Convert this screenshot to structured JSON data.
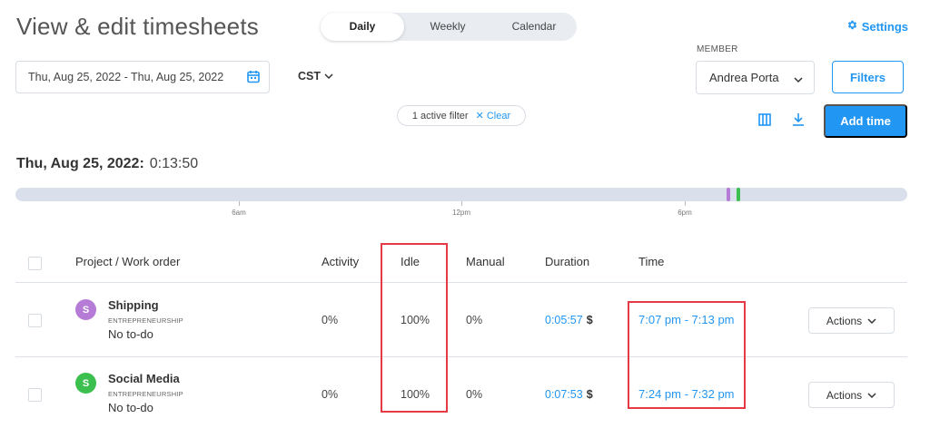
{
  "header": {
    "title": "View & edit timesheets",
    "view_options": [
      "Daily",
      "Weekly",
      "Calendar"
    ],
    "active_view": "Daily",
    "settings_label": "Settings"
  },
  "toolbar": {
    "date_range": "Thu, Aug 25, 2022 - Thu, Aug 25, 2022",
    "timezone": "CST",
    "member_label": "MEMBER",
    "member_value": "Andrea Porta",
    "filters_label": "Filters",
    "active_filter_text": "1 active filter",
    "clear_label": "Clear",
    "add_time_label": "Add time"
  },
  "day": {
    "date": "Thu, Aug 25, 2022:",
    "total": "0:13:50",
    "timeline_ticks": [
      "6am",
      "12pm",
      "6pm"
    ],
    "segments": [
      {
        "color": "#b57bd6"
      },
      {
        "color": "#3bbf4e"
      }
    ]
  },
  "table": {
    "columns": [
      "Project / Work order",
      "Activity",
      "Idle",
      "Manual",
      "Duration",
      "Time"
    ],
    "rows": [
      {
        "avatar_letter": "S",
        "avatar_color": "#b57bd6",
        "project": "Shipping",
        "client": "ENTREPRENEURSHIP",
        "todo": "No to-do",
        "activity": "0%",
        "idle": "100%",
        "manual": "0%",
        "duration": "0:05:57",
        "currency": "$",
        "time": "7:07 pm - 7:13 pm",
        "actions_label": "Actions"
      },
      {
        "avatar_letter": "S",
        "avatar_color": "#3bbf4e",
        "project": "Social Media",
        "client": "ENTREPRENEURSHIP",
        "todo": "No to-do",
        "activity": "0%",
        "idle": "100%",
        "manual": "0%",
        "duration": "0:07:53",
        "currency": "$",
        "time": "7:24 pm - 7:32 pm",
        "actions_label": "Actions"
      }
    ]
  },
  "colors": {
    "accent": "#2196f3",
    "highlight": "#e63946"
  }
}
